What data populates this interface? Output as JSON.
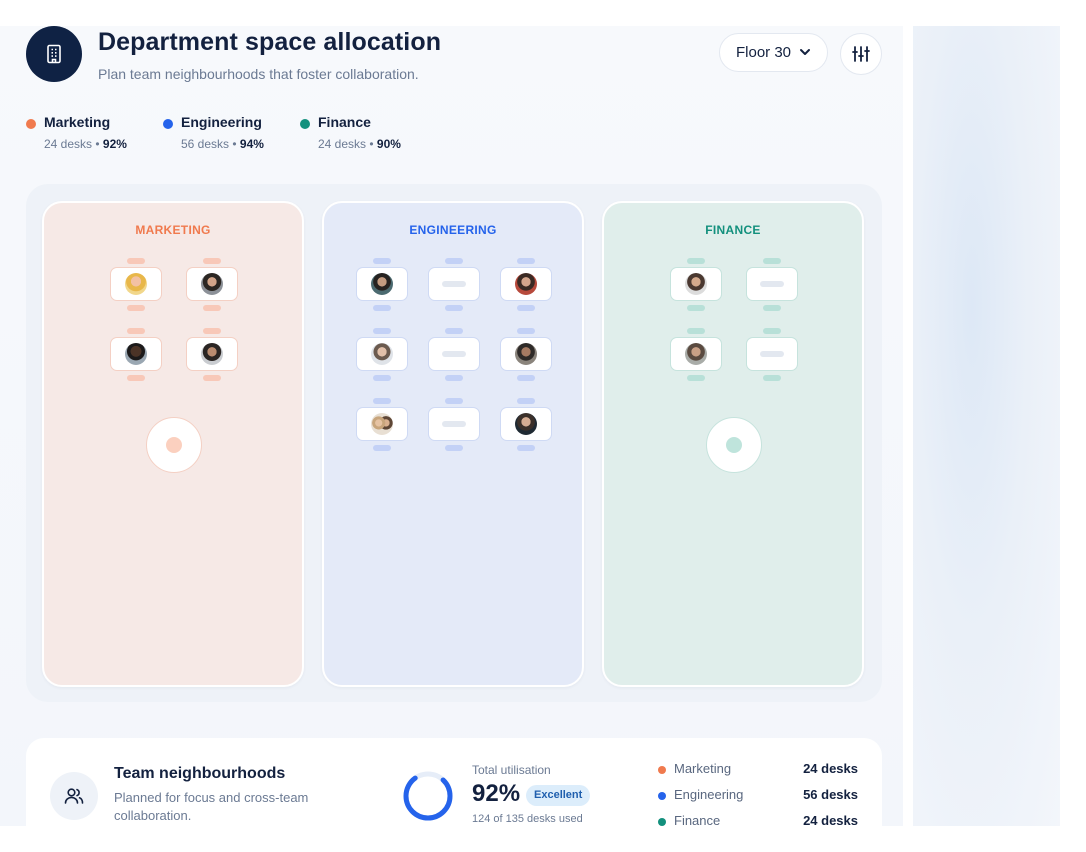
{
  "header": {
    "title": "Department space allocation",
    "subtitle": "Plan team neighbourhoods that foster collaboration.",
    "floor_select": "Floor 30",
    "icon": "building-icon",
    "filter_icon": "sliders-icon"
  },
  "colors": {
    "marketing": "#f07a4e",
    "engineering": "#2563eb",
    "finance": "#13907d",
    "navy": "#0f2244"
  },
  "legend": [
    {
      "name": "Marketing",
      "desks": "24 desks",
      "sep": "•",
      "pct": "92%"
    },
    {
      "name": "Engineering",
      "desks": "56 desks",
      "sep": "•",
      "pct": "94%"
    },
    {
      "name": "Finance",
      "desks": "24 desks",
      "sep": "•",
      "pct": "90%"
    }
  ],
  "zones": {
    "marketing": {
      "label": "MARKETING"
    },
    "engineering": {
      "label": "ENGINEERING"
    },
    "finance": {
      "label": "FINANCE"
    }
  },
  "summary": {
    "title": "Team neighbourhoods",
    "subtitle": "Planned for focus and cross-team collaboration.",
    "util_label": "Total utilisation",
    "util_value": "92%",
    "util_fraction": 0.92,
    "badge": "Excellent",
    "footnote": "124 of 135 desks used",
    "rows": [
      {
        "name": "Marketing",
        "value": "24 desks"
      },
      {
        "name": "Engineering",
        "value": "56 desks"
      },
      {
        "name": "Finance",
        "value": "24 desks"
      }
    ]
  }
}
